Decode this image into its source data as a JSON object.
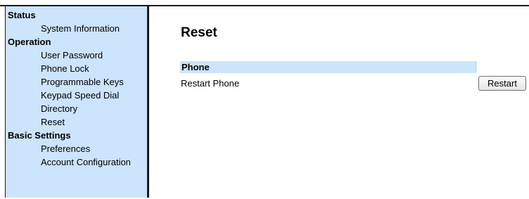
{
  "sidebar": {
    "sections": [
      {
        "title": "Status",
        "items": [
          "System Information"
        ]
      },
      {
        "title": "Operation",
        "items": [
          "User Password",
          "Phone Lock",
          "Programmable Keys",
          "Keypad Speed Dial",
          "Directory",
          "Reset"
        ]
      },
      {
        "title": "Basic Settings",
        "items": [
          "Preferences",
          "Account Configuration"
        ]
      }
    ]
  },
  "main": {
    "title": "Reset",
    "section_header": "Phone",
    "rows": [
      {
        "label": "Restart Phone",
        "button_label": "Restart"
      }
    ]
  },
  "colors": {
    "sidebar_bg": "#cce4fc",
    "section_header_bg": "#cce4fc",
    "border": "#1a1a1a"
  }
}
